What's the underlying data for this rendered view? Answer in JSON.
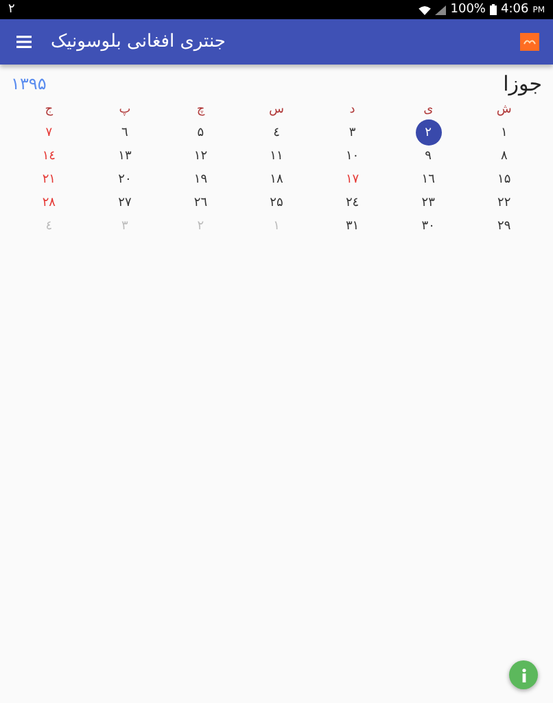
{
  "status_bar": {
    "notification": "۲",
    "battery": "100%",
    "time": "4:06",
    "ampm": "PM"
  },
  "app_bar": {
    "title": "جنتری افغانی بلوسونیک"
  },
  "month": {
    "name": "جوزا",
    "year": "۱۳۹۵"
  },
  "weekdays": [
    "ش",
    "ی",
    "د",
    "س",
    "چ",
    "پ",
    "ج"
  ],
  "weeks": [
    [
      {
        "day": "۱",
        "kind": "normal",
        "selected": false
      },
      {
        "day": "۲",
        "kind": "normal",
        "selected": true
      },
      {
        "day": "۳",
        "kind": "normal",
        "selected": false
      },
      {
        "day": "٤",
        "kind": "normal",
        "selected": false
      },
      {
        "day": "۵",
        "kind": "normal",
        "selected": false
      },
      {
        "day": "٦",
        "kind": "normal",
        "selected": false
      },
      {
        "day": "۷",
        "kind": "holiday",
        "selected": false
      }
    ],
    [
      {
        "day": "۸",
        "kind": "normal",
        "selected": false
      },
      {
        "day": "۹",
        "kind": "normal",
        "selected": false
      },
      {
        "day": "۱۰",
        "kind": "normal",
        "selected": false
      },
      {
        "day": "۱۱",
        "kind": "normal",
        "selected": false
      },
      {
        "day": "۱۲",
        "kind": "normal",
        "selected": false
      },
      {
        "day": "۱۳",
        "kind": "normal",
        "selected": false
      },
      {
        "day": "۱٤",
        "kind": "holiday",
        "selected": false
      }
    ],
    [
      {
        "day": "۱۵",
        "kind": "normal",
        "selected": false
      },
      {
        "day": "۱٦",
        "kind": "normal",
        "selected": false
      },
      {
        "day": "۱۷",
        "kind": "holiday",
        "selected": false
      },
      {
        "day": "۱۸",
        "kind": "normal",
        "selected": false
      },
      {
        "day": "۱۹",
        "kind": "normal",
        "selected": false
      },
      {
        "day": "۲۰",
        "kind": "normal",
        "selected": false
      },
      {
        "day": "۲۱",
        "kind": "holiday",
        "selected": false
      }
    ],
    [
      {
        "day": "۲۲",
        "kind": "normal",
        "selected": false
      },
      {
        "day": "۲۳",
        "kind": "normal",
        "selected": false
      },
      {
        "day": "۲٤",
        "kind": "normal",
        "selected": false
      },
      {
        "day": "۲۵",
        "kind": "normal",
        "selected": false
      },
      {
        "day": "۲٦",
        "kind": "normal",
        "selected": false
      },
      {
        "day": "۲۷",
        "kind": "normal",
        "selected": false
      },
      {
        "day": "۲۸",
        "kind": "holiday",
        "selected": false
      }
    ],
    [
      {
        "day": "۲۹",
        "kind": "normal",
        "selected": false
      },
      {
        "day": "۳۰",
        "kind": "normal",
        "selected": false
      },
      {
        "day": "۳۱",
        "kind": "normal",
        "selected": false
      },
      {
        "day": "۱",
        "kind": "other",
        "selected": false
      },
      {
        "day": "۲",
        "kind": "other",
        "selected": false
      },
      {
        "day": "۳",
        "kind": "other",
        "selected": false
      },
      {
        "day": "٤",
        "kind": "other",
        "selected": false
      }
    ]
  ]
}
